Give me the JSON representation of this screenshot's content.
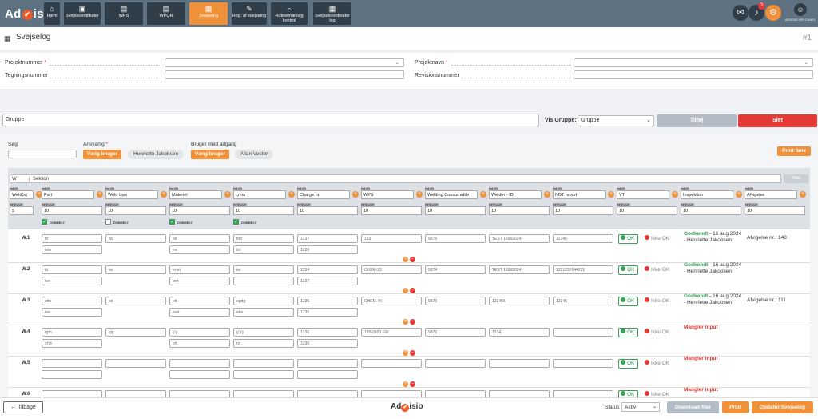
{
  "topbar": {
    "logo_left": "Ad",
    "logo_right": "isio",
    "nav": [
      {
        "label": "Hjem",
        "icon": "home-icon"
      },
      {
        "label": "Svejsecertifikater",
        "icon": "certificate-icon"
      },
      {
        "label": "WPS",
        "icon": "document-icon"
      },
      {
        "label": "WPQR",
        "icon": "document-icon"
      },
      {
        "label": "Svejselog",
        "icon": "log-icon",
        "active": true
      },
      {
        "label": "Reg. af svejselog",
        "icon": "edit-icon"
      },
      {
        "label": "Rutinemæssig kontrol",
        "icon": "search-icon"
      },
      {
        "label": "Svejsekoordinator log",
        "icon": "calendar-icon"
      }
    ],
    "notification_count": "3",
    "user_name": "ADVISIO API CHAEL"
  },
  "page": {
    "title": "Svejselog",
    "number": "#1"
  },
  "project": {
    "projektnummer_label": "Projektnummer",
    "projektnavn_label": "Projektnavn",
    "tegningsnummer_label": "Tegningsnummer",
    "revisionsnummer_label": "Revisionsnummer",
    "required_mark": "*"
  },
  "group": {
    "placeholder": "Gruppe",
    "vis_label": "Vis Gruppe:",
    "select_value": "Gruppe",
    "add_label": "Tilføj",
    "delete_label": "Slet"
  },
  "filters": {
    "search_label": "Søg",
    "ansvarlig_label": "Ansvarlig",
    "choose_user_label": "Vælg bruger",
    "ansvarlig_user": "Henriette Jakobsen",
    "access_label": "Bruger med adgang",
    "access_user": "Allan Vester",
    "print_tab_label": "Print fane"
  },
  "table": {
    "section_w": "W",
    "section_label": "Sektion",
    "add_col_label": "Tilføj",
    "name_label": "NAVN",
    "width_label": "BREDDE",
    "double_label": "DOBBELT",
    "columns": [
      {
        "name": "Weld(s)",
        "width": "5"
      },
      {
        "name": "Part",
        "width": "10",
        "double": true
      },
      {
        "name": "Weld type",
        "width": "10",
        "double": false
      },
      {
        "name": "Materiel",
        "width": "10",
        "double": true
      },
      {
        "name": "t,mm",
        "width": "10",
        "double": true
      },
      {
        "name": "Charge nr.",
        "width": "10"
      },
      {
        "name": "WPS",
        "width": "10"
      },
      {
        "name": "Welding Consumable I",
        "width": "10"
      },
      {
        "name": "Welder - ID",
        "width": "10"
      },
      {
        "name": "NDT report",
        "width": "10"
      },
      {
        "name": "VT",
        "width": "10"
      },
      {
        "name": "Inspektion",
        "width": "10"
      },
      {
        "name": "Afvigelse",
        "width": "10"
      }
    ],
    "ok_label": "OK",
    "not_ok_label": "Ikke OK",
    "rows": [
      {
        "label": "W.1",
        "part": [
          "ttr",
          "tete"
        ],
        "weldtype": [
          "tw"
        ],
        "materiel": [
          "tet",
          "tre"
        ],
        "tmm": [
          "tntt",
          "ttrr"
        ],
        "charge": [
          "1237",
          "1236"
        ],
        "wps": "133",
        "consumable": "9876",
        "welder": "TEST 16082024",
        "ndt": "12345",
        "status": "Godkendt",
        "date": "16 aug 2024",
        "by": "Henriette Jakobsen",
        "afv": "Afvigelse nr.: 148"
      },
      {
        "label": "W.2",
        "part": [
          "ttt",
          "tee"
        ],
        "weldtype": [
          "tet"
        ],
        "materiel": [
          "ertet",
          "tert"
        ],
        "tmm": [
          "tet",
          ""
        ],
        "charge": [
          "1234",
          "1237"
        ],
        "wps": "CHEM-33",
        "consumable": "9874",
        "welder": "TEST 16082024",
        "ndt": "1231232144231",
        "status": "Godkendt",
        "date": "16 aug 2024",
        "by": "Henriette Jakobsen",
        "afv": ""
      },
      {
        "label": "W.3",
        "part": [
          "ette",
          "tee"
        ],
        "weldtype": [
          "tet"
        ],
        "materiel": [
          "ett",
          "teet"
        ],
        "tmm": [
          "egdg",
          "ette"
        ],
        "charge": [
          "1235",
          "1236"
        ],
        "wps": "CHEM-40",
        "consumable": "9876",
        "welder": "123456",
        "ndt": "12345",
        "status": "Godkendt",
        "date": "16 aug 2024",
        "by": "Henriette Jakobsen",
        "afv": "Afvigelse nr.: 111"
      },
      {
        "label": "W.4",
        "part": [
          "rgth",
          "yt'yt"
        ],
        "weldtype": [
          "yty"
        ],
        "materiel": [
          "y'y",
          "yrt"
        ],
        "tmm": [
          "y'y'y",
          "ryt"
        ],
        "charge": [
          "1236",
          "1236"
        ],
        "wps": "135-0800 FW",
        "consumable": "9876",
        "welder": "1234",
        "ndt": "",
        "status": "Mangler input",
        "date": "",
        "by": "",
        "afv": ""
      },
      {
        "label": "W.5",
        "part": [
          "",
          ""
        ],
        "weldtype": [
          ""
        ],
        "materiel": [
          "",
          ""
        ],
        "tmm": [
          "",
          ""
        ],
        "charge": [
          "",
          ""
        ],
        "wps": "",
        "consumable": "",
        "welder": "",
        "ndt": "",
        "status": "Mangler input",
        "date": "",
        "by": "",
        "afv": ""
      },
      {
        "label": "W.6",
        "part": [
          "",
          ""
        ],
        "weldtype": [
          ""
        ],
        "materiel": [
          "",
          ""
        ],
        "tmm": [
          "",
          ""
        ],
        "charge": [
          "",
          ""
        ],
        "wps": "",
        "consumable": "",
        "welder": "",
        "ndt": "",
        "status": "Mangler input",
        "date": "",
        "by": "",
        "afv": ""
      }
    ]
  },
  "footer": {
    "back_label": "Tilbage",
    "status_label": "Status",
    "status_value": "Aktiv",
    "download_label": "Download filer",
    "print_label": "Print",
    "update_label": "Opdater Svejselog"
  },
  "colors": {
    "orange": "#f0913a",
    "red": "#e53935",
    "green": "#3aa05a",
    "topbar": "#5f7282"
  }
}
